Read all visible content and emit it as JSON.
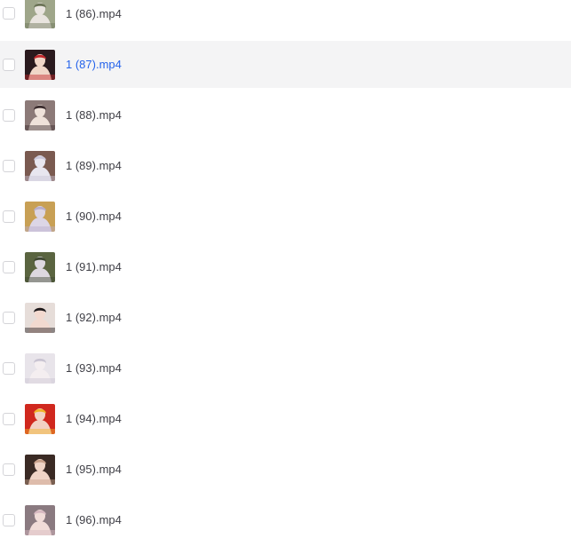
{
  "files": [
    {
      "name": "1 (86).mp4",
      "selected": false,
      "hovered": false,
      "thumb": {
        "bg": "#9fa68a",
        "fg": "#e9e4df",
        "accent": "#6b7356"
      }
    },
    {
      "name": "1 (87).mp4",
      "selected": false,
      "hovered": true,
      "thumb": {
        "bg": "#2a1a1e",
        "fg": "#f0d6c8",
        "accent": "#c0262b"
      }
    },
    {
      "name": "1 (88).mp4",
      "selected": false,
      "hovered": false,
      "thumb": {
        "bg": "#8c7a78",
        "fg": "#efe2da",
        "accent": "#3a2b2d"
      }
    },
    {
      "name": "1 (89).mp4",
      "selected": false,
      "hovered": false,
      "thumb": {
        "bg": "#7a5a50",
        "fg": "#e8e6ef",
        "accent": "#c9c6d8"
      }
    },
    {
      "name": "1 (90).mp4",
      "selected": false,
      "hovered": false,
      "thumb": {
        "bg": "#c8a055",
        "fg": "#dcd6e6",
        "accent": "#b8aecb"
      }
    },
    {
      "name": "1 (91).mp4",
      "selected": false,
      "hovered": false,
      "thumb": {
        "bg": "#5a6440",
        "fg": "#ddd8e0",
        "accent": "#3e4630"
      }
    },
    {
      "name": "1 (92).mp4",
      "selected": false,
      "hovered": false,
      "thumb": {
        "bg": "#e6ddd9",
        "fg": "#f2d9cf",
        "accent": "#1e1a1c"
      }
    },
    {
      "name": "1 (93).mp4",
      "selected": false,
      "hovered": false,
      "thumb": {
        "bg": "#e8e4ea",
        "fg": "#f4eef0",
        "accent": "#c9c4d2"
      }
    },
    {
      "name": "1 (94).mp4",
      "selected": false,
      "hovered": false,
      "thumb": {
        "bg": "#d0281e",
        "fg": "#f2d2c4",
        "accent": "#f0b428"
      }
    },
    {
      "name": "1 (95).mp4",
      "selected": false,
      "hovered": false,
      "thumb": {
        "bg": "#3a2a24",
        "fg": "#f0d4c6",
        "accent": "#c8a08a"
      }
    },
    {
      "name": "1 (96).mp4",
      "selected": false,
      "hovered": false,
      "thumb": {
        "bg": "#8a7a80",
        "fg": "#f0dcd8",
        "accent": "#d6b8c0"
      }
    }
  ]
}
